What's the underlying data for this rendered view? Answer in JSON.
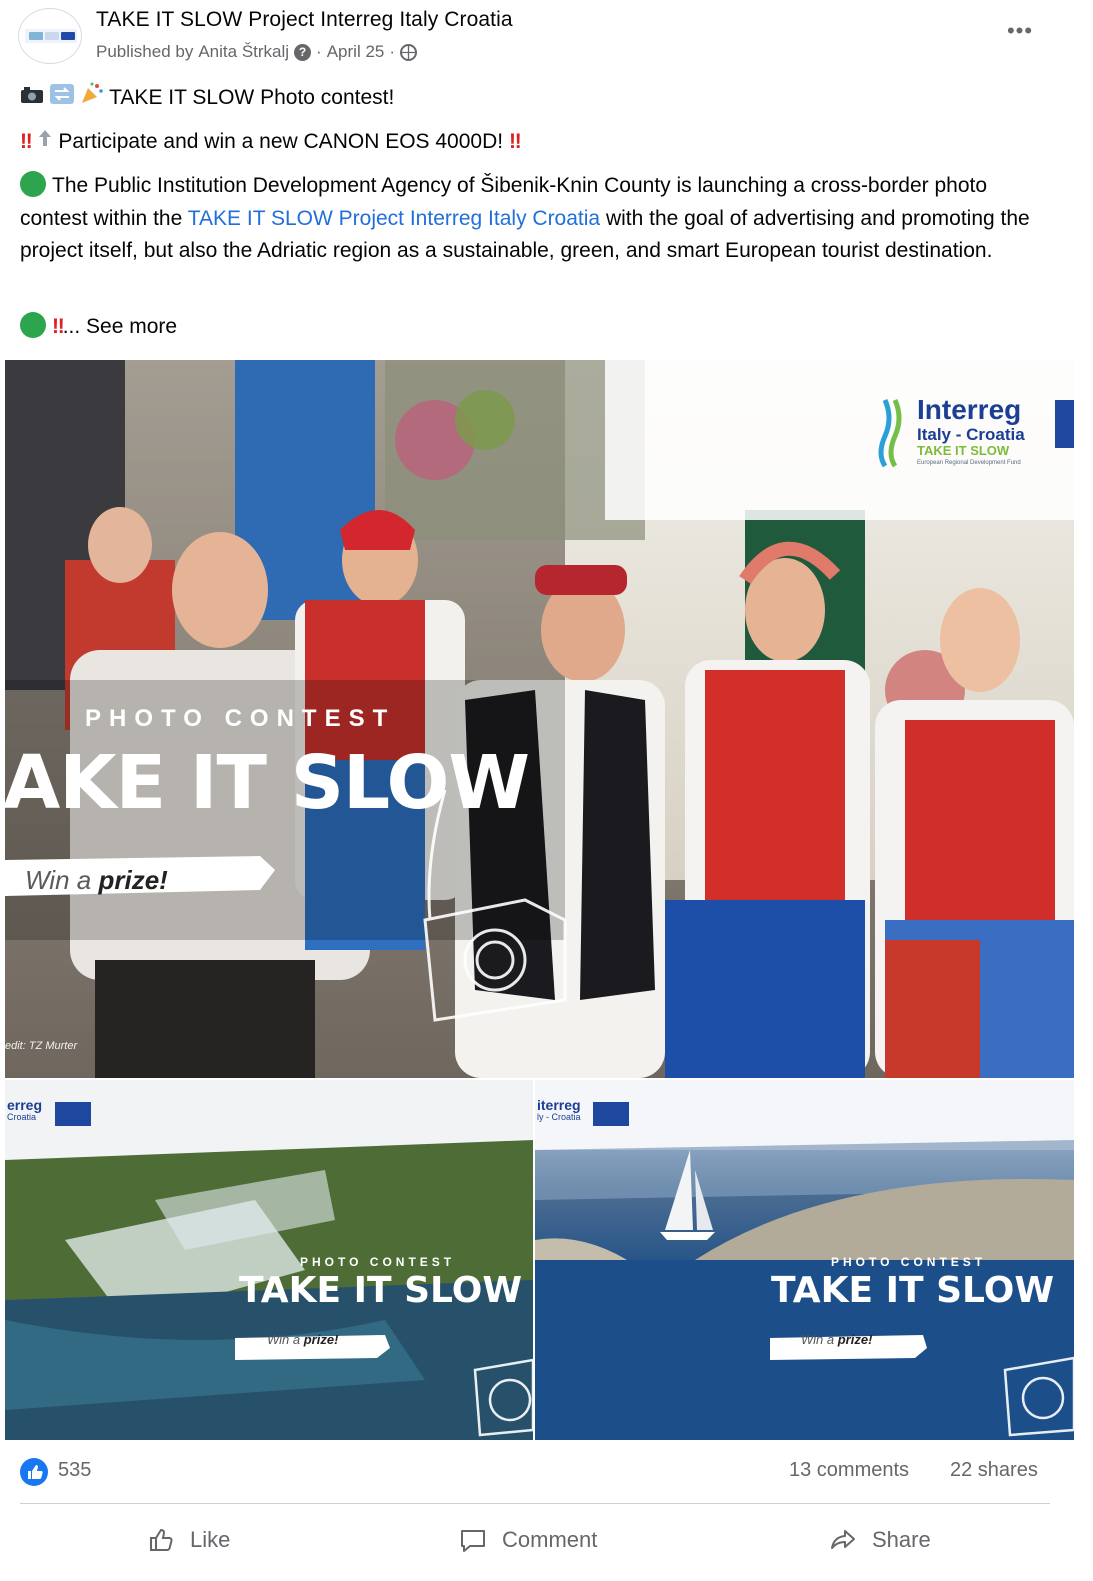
{
  "post": {
    "page_name": "TAKE IT SLOW Project Interreg Italy Croatia",
    "published_prefix": "Published by",
    "author": "Anita Štrkalj",
    "separator": "·",
    "date": "April 25",
    "more_label": "•••"
  },
  "body": {
    "line1_text": "TAKE IT SLOW Photo contest!",
    "line2_text": "Participate and win a new CANON EOS 4000D!",
    "para_before_link": "The Public Institution Development Agency of Šibenik-Knin County is launching a cross-border photo contest within the",
    "para_link": "TAKE IT SLOW Project Interreg Italy Croatia",
    "para_after_link": "with the goal of advertising and promoting the project itself, but also the Adriatic region as a sustainable, green, and smart European tourist destination.",
    "see_more": "... See more"
  },
  "images": {
    "main": {
      "logo_interreg": "Interreg",
      "logo_region": "Italy - Croatia",
      "logo_project": "TAKE IT SLOW",
      "logo_fund": "European Regional Development Fund",
      "kicker": "PHOTO CONTEST",
      "headline": "AKE IT SLOW",
      "win_prefix": "Win a ",
      "win_emph": "prize!",
      "credit": "edit: TZ Murter"
    },
    "left": {
      "logo_interreg": "erreg",
      "logo_region": "Croatia",
      "kicker": "PHOTO CONTEST",
      "headline": "TAKE IT SLOW",
      "win_prefix": "Win a ",
      "win_emph": "prize!"
    },
    "right": {
      "logo_interreg": "iterreg",
      "logo_region": "ly - Croatia",
      "kicker": "PHOTO CONTEST",
      "headline": "TAKE IT SLOW",
      "win_prefix": "Win a ",
      "win_emph": "prize!"
    }
  },
  "stats": {
    "reactions": "535",
    "comments": "13 comments",
    "shares": "22 shares"
  },
  "actions": {
    "like": "Like",
    "comment": "Comment",
    "share": "Share"
  },
  "colors": {
    "link": "#216fdb",
    "secondary_text": "#65676b",
    "like_blue": "#1877f2",
    "alert_red": "#e02020",
    "green_dot": "#2da44e"
  }
}
